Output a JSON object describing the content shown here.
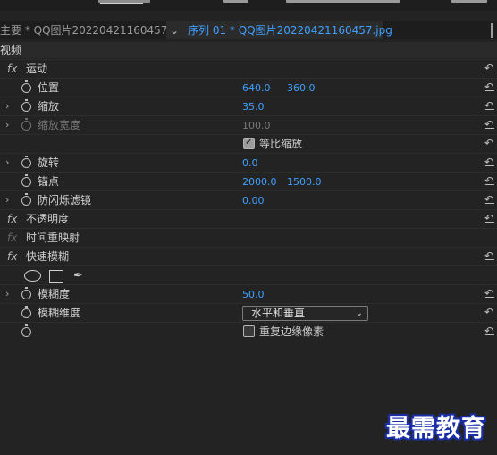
{
  "tabs": {
    "source_label": "主要 * QQ图片20220421160457.jpg",
    "sequence_label": "序列 01 * QQ图片20220421160457.jpg"
  },
  "section_label": "视频",
  "effects": {
    "motion": {
      "name": "运动",
      "position": {
        "label": "位置",
        "x": "640.0",
        "y": "360.0"
      },
      "scale": {
        "label": "缩放",
        "value": "35.0"
      },
      "scale_width": {
        "label": "缩放宽度",
        "value": "100.0"
      },
      "uniform_scale": {
        "label": "等比缩放",
        "checked": true
      },
      "rotation": {
        "label": "旋转",
        "value": "0.0"
      },
      "anchor": {
        "label": "锚点",
        "x": "2000.0",
        "y": "1500.0"
      },
      "anti_flicker": {
        "label": "防闪烁滤镜",
        "value": "0.00"
      }
    },
    "opacity": {
      "name": "不透明度"
    },
    "time_remap": {
      "name": "时间重映射"
    },
    "fast_blur": {
      "name": "快速模糊",
      "blurriness": {
        "label": "模糊度",
        "value": "50.0"
      },
      "blur_dimensions": {
        "label": "模糊维度",
        "value": "水平和垂直"
      },
      "repeat_edge": {
        "label": "重复边缘像素",
        "checked": false
      }
    }
  },
  "watermark": "最需教育"
}
